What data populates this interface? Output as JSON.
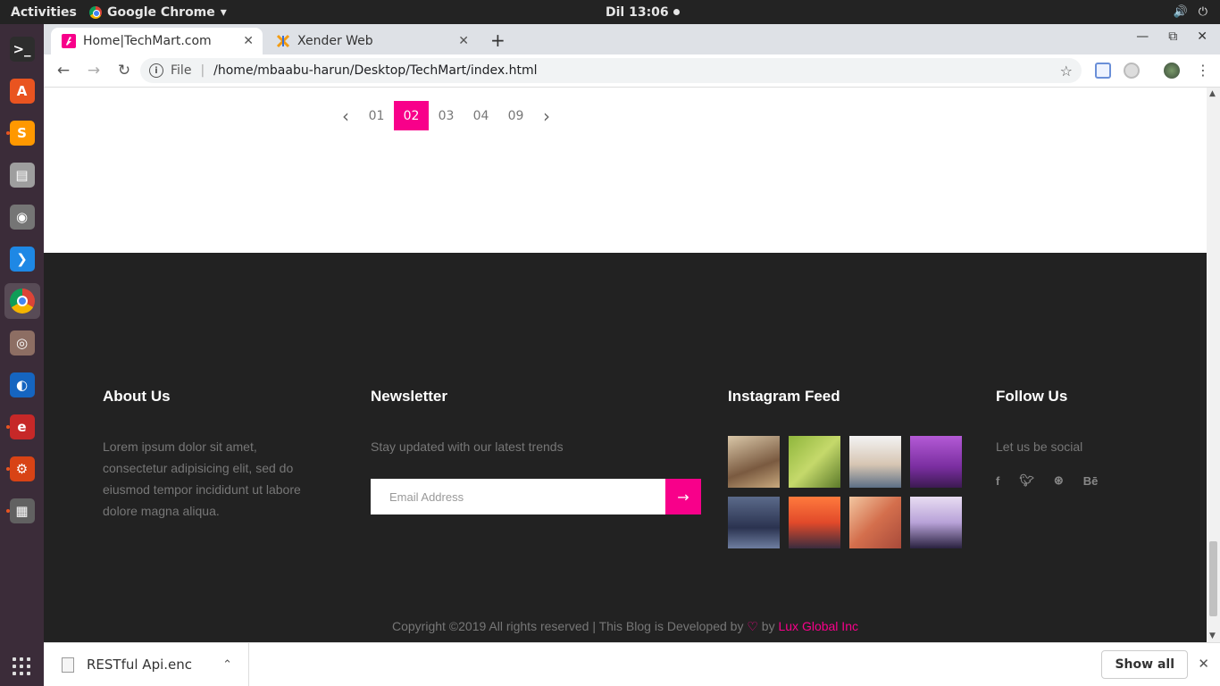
{
  "system": {
    "activities": "Activities",
    "app_name": "Google Chrome",
    "app_caret": "▾",
    "clock": "Dil 13:06",
    "tray": [
      "🔊",
      "⏻"
    ]
  },
  "dock": {
    "apps": [
      {
        "name": "terminal",
        "glyph": ">_",
        "color": "#2d2d2d"
      },
      {
        "name": "software-center",
        "glyph": "A",
        "color": "#e95420"
      },
      {
        "name": "sublime-text",
        "glyph": "S",
        "color": "#ff9800"
      },
      {
        "name": "files",
        "glyph": "▤",
        "color": "#9e9e9e"
      },
      {
        "name": "screenshot",
        "glyph": "◉",
        "color": "#757575"
      },
      {
        "name": "vscode",
        "glyph": "❯",
        "color": "#1e88e5"
      },
      {
        "name": "chrome",
        "glyph": "",
        "color": "#4285f4"
      },
      {
        "name": "camera",
        "glyph": "◎",
        "color": "#8d6e63"
      },
      {
        "name": "browser",
        "glyph": "◐",
        "color": "#1565c0"
      },
      {
        "name": "document-viewer",
        "glyph": "e",
        "color": "#c62828"
      },
      {
        "name": "settings",
        "glyph": "⚙",
        "color": "#d84315"
      },
      {
        "name": "printer",
        "glyph": "▦",
        "color": "#616161"
      }
    ]
  },
  "browser": {
    "tabs": [
      {
        "title": "Home|TechMart.com",
        "close": "✕"
      },
      {
        "title": "Xender Web",
        "close": "✕"
      }
    ],
    "new_tab": "+",
    "window_controls": {
      "minimize": "—",
      "maximize": "⧉",
      "close": "✕"
    },
    "nav": {
      "back": "←",
      "forward": "→",
      "reload": "↻"
    },
    "address": {
      "scheme": "File",
      "separator": "|",
      "url": "/home/mbaabu-harun/Desktop/TechMart/index.html",
      "bookmark": "☆",
      "info": "i"
    }
  },
  "page": {
    "pagination": {
      "prev": "‹",
      "next": "›",
      "pages": [
        "01",
        "02",
        "03",
        "04",
        "09"
      ],
      "current": "02"
    },
    "footer": {
      "about": {
        "title": "About Us",
        "text": "Lorem ipsum dolor sit amet, consectetur adipisicing elit, sed do eiusmod tempor incididunt ut labore dolore magna aliqua."
      },
      "newsletter": {
        "title": "Newsletter",
        "text": "Stay updated with our latest trends",
        "placeholder": "Email Address",
        "submit": "→"
      },
      "instagram": {
        "title": "Instagram Feed",
        "thumbs": [
          {
            "name": "child-walking-photo",
            "bg": "linear-gradient(160deg,#d9c7a8,#7a5a40 60%,#c8a97e)"
          },
          {
            "name": "rice-terrace-photo",
            "bg": "linear-gradient(135deg,#8fb63c,#c5d96b 50%,#5c7a2a)"
          },
          {
            "name": "girl-backpack-photo",
            "bg": "linear-gradient(180deg,#f3f3f3,#d7c6b3 55%,#5d6f86)"
          },
          {
            "name": "taj-mahal-photo",
            "bg": "linear-gradient(180deg,#b45ad6,#7a2ea0 60%,#3c1a52)"
          },
          {
            "name": "traveler-suitcase-photo",
            "bg": "linear-gradient(180deg,#5b6a8a,#2b3350 60%,#6e7ea0)"
          },
          {
            "name": "sunset-beach-photo",
            "bg": "linear-gradient(180deg,#ff7a3d,#e24a2a 50%,#3a2c3e)"
          },
          {
            "name": "woman-hat-photo",
            "bg": "linear-gradient(135deg,#f2c6a0,#d46f4d 50%,#a84a3a)"
          },
          {
            "name": "child-hood-photo",
            "bg": "linear-gradient(180deg,#e8dcf2,#b8a2d8 50%,#2a2240)"
          }
        ]
      },
      "follow": {
        "title": "Follow Us",
        "text": "Let us be social",
        "icons": [
          {
            "name": "facebook-icon",
            "glyph": "f"
          },
          {
            "name": "twitter-icon",
            "glyph": "🐦︎"
          },
          {
            "name": "dribbble-icon",
            "glyph": "⊛"
          },
          {
            "name": "behance-icon",
            "glyph": "Bē"
          }
        ]
      },
      "copyright": {
        "before": "Copyright ©2019 All rights reserved | This Blog is Developed by",
        "heart": "♡",
        "by": "by",
        "brand": "Lux Global Inc"
      }
    },
    "colors": {
      "accent": "#f8008a",
      "footer_bg": "#222222"
    }
  },
  "downloads": {
    "file": "RESTful Api.enc",
    "chevron": "⌃",
    "show_all": "Show all",
    "close": "✕"
  }
}
